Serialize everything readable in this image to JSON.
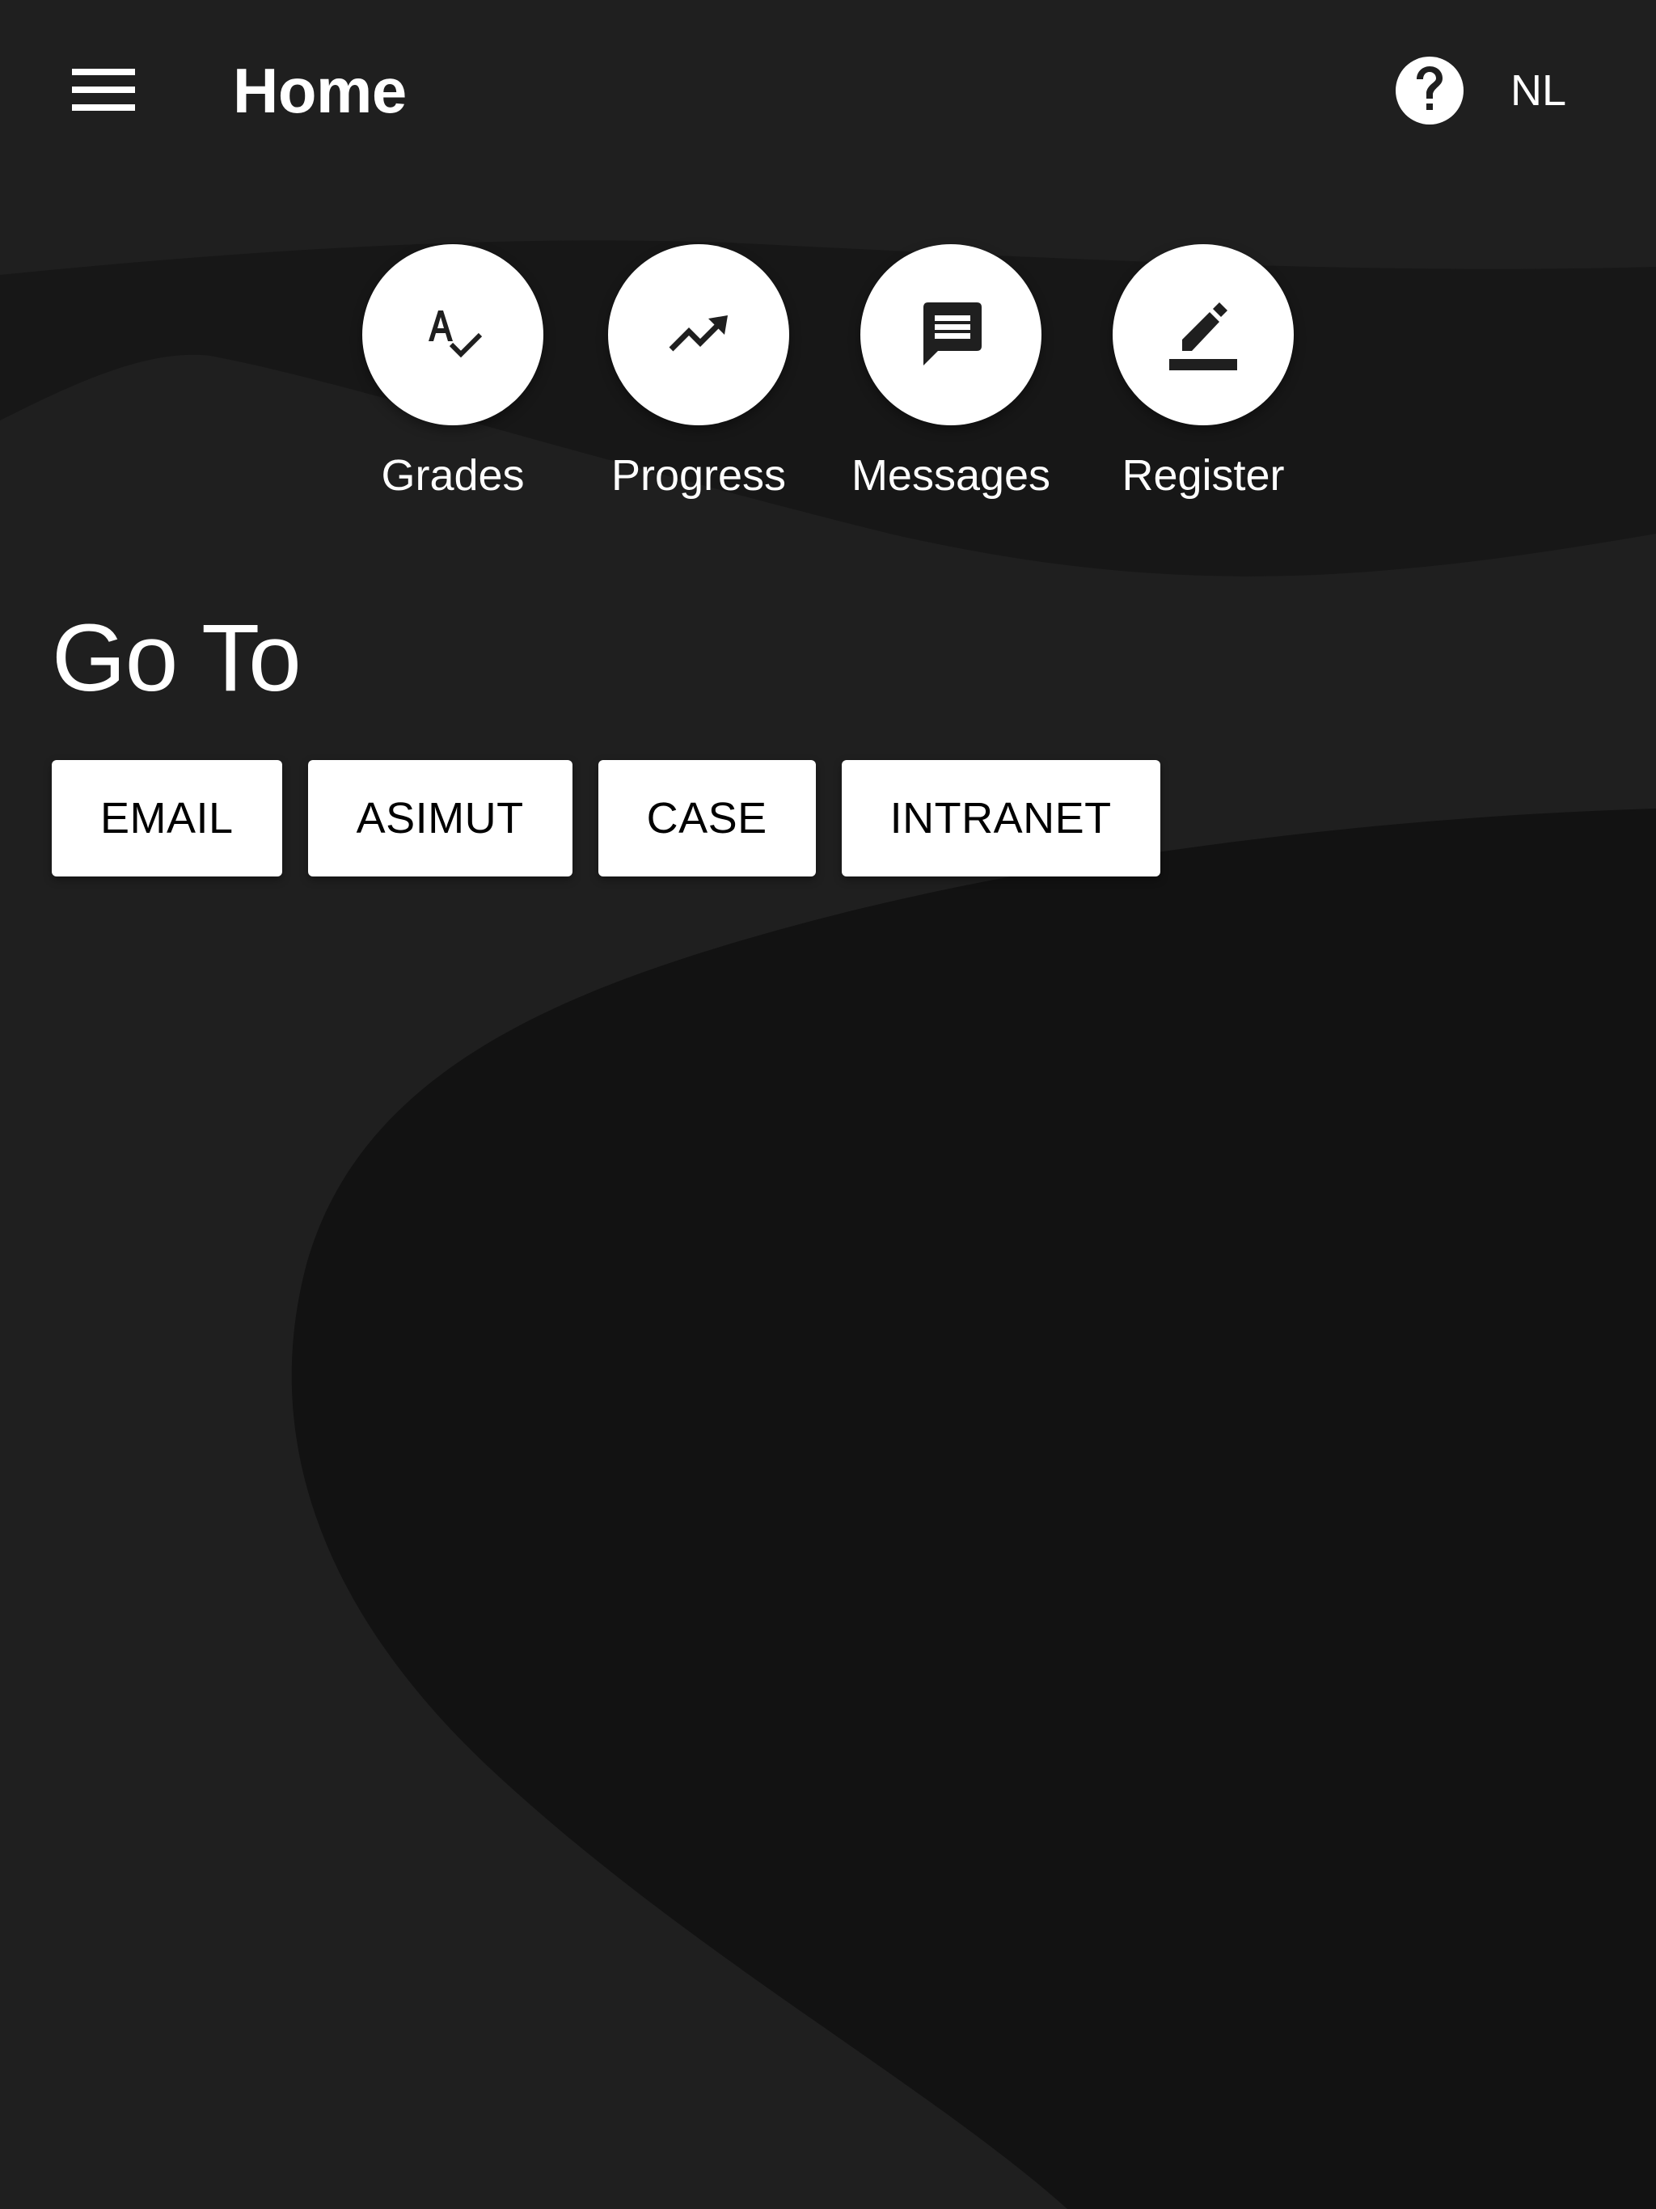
{
  "header": {
    "title": "Home",
    "menu_icon": "hamburger-menu-icon",
    "help_icon": "help-circle-icon",
    "language_label": "NL"
  },
  "quick_actions": [
    {
      "label": "Grades",
      "icon": "spellcheck-icon"
    },
    {
      "label": "Progress",
      "icon": "trending-up-icon"
    },
    {
      "label": "Messages",
      "icon": "message-icon"
    },
    {
      "label": "Register",
      "icon": "edit-pencil-icon"
    }
  ],
  "goto": {
    "title": "Go To",
    "buttons": [
      {
        "label": "EMAIL"
      },
      {
        "label": "ASIMUT"
      },
      {
        "label": "CASE"
      },
      {
        "label": "INTRANET"
      }
    ]
  },
  "colors": {
    "background": "#1f1f1f",
    "background_shape": "#121212",
    "foreground": "#ffffff",
    "icon_dark": "#1f1f1f"
  }
}
